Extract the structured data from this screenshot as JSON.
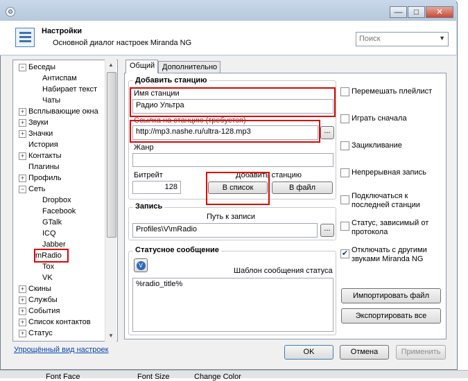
{
  "window": {
    "controls": [
      "—",
      "□",
      "✕"
    ]
  },
  "header": {
    "title": "Настройки",
    "subtitle": "Основной диалог настроек Miranda NG"
  },
  "search": {
    "placeholder": "Поиск"
  },
  "tree": {
    "items": [
      {
        "label": "Беседы",
        "level": 0,
        "expander": "−"
      },
      {
        "label": "Антиспам",
        "level": 1
      },
      {
        "label": "Набирает текст",
        "level": 1
      },
      {
        "label": "Чаты",
        "level": 1
      },
      {
        "label": "Всплывающие окна",
        "level": 0,
        "expander": "+"
      },
      {
        "label": "Звуки",
        "level": 0,
        "expander": "+"
      },
      {
        "label": "Значки",
        "level": 0,
        "expander": "+"
      },
      {
        "label": "История",
        "level": 0
      },
      {
        "label": "Контакты",
        "level": 0,
        "expander": "+"
      },
      {
        "label": "Плагины",
        "level": 0
      },
      {
        "label": "Профиль",
        "level": 0,
        "expander": "+"
      },
      {
        "label": "Сеть",
        "level": 0,
        "expander": "−"
      },
      {
        "label": "Dropbox",
        "level": 1
      },
      {
        "label": "Facebook",
        "level": 1
      },
      {
        "label": "GTalk",
        "level": 1
      },
      {
        "label": "ICQ",
        "level": 1
      },
      {
        "label": "Jabber",
        "level": 1
      },
      {
        "label": "mRadio",
        "level": 1,
        "selected": true
      },
      {
        "label": "Tox",
        "level": 1
      },
      {
        "label": "VK",
        "level": 1
      },
      {
        "label": "Скины",
        "level": 0,
        "expander": "+"
      },
      {
        "label": "Службы",
        "level": 0,
        "expander": "+"
      },
      {
        "label": "События",
        "level": 0,
        "expander": "+"
      },
      {
        "label": "Список контактов",
        "level": 0,
        "expander": "+"
      },
      {
        "label": "Статус",
        "level": 0,
        "expander": "+"
      }
    ]
  },
  "simplified_link": "Упрощённый вид настроек",
  "tabs": [
    "Общий",
    "Дополнительно"
  ],
  "add_station": {
    "title": "Добавить станцию",
    "name_label": "Имя станции",
    "name_value": "Радио Ультра",
    "url_label": "Ссылка на станцию (требуется)",
    "url_value": "http://mp3.nashe.ru/ultra-128.mp3",
    "browse": "...",
    "genre_label": "Жанр",
    "genre_value": "",
    "bitrate_label": "Битрейт",
    "bitrate_value": "128",
    "add_label": "Добавить станцию",
    "to_list": "В список",
    "to_file": "В файл"
  },
  "record": {
    "title": "Запись",
    "path_label": "Путь к записи",
    "path_value": "Profiles\\V\\mRadio",
    "browse": "..."
  },
  "status_msg": {
    "title": "Статусное сообщение",
    "template_label": "Шаблон сообщения статуса",
    "template_value": "%radio_title%"
  },
  "checkboxes": [
    {
      "label": "Перемешать плейлист",
      "checked": false
    },
    {
      "label": "Играть сначала",
      "checked": false
    },
    {
      "label": "Зацикливание",
      "checked": false
    },
    {
      "label": "Непрерывная запись",
      "checked": false
    },
    {
      "label": "Подключаться к последней станции",
      "checked": false
    },
    {
      "label": "Статус, зависимый от протокола",
      "checked": false
    },
    {
      "label": "Отключать с другими звуками Miranda NG",
      "checked": true
    }
  ],
  "buttons": {
    "import": "Импортировать файл",
    "export": "Экспортировать все",
    "ok": "OK",
    "cancel": "Отмена",
    "apply": "Применить"
  },
  "taskbar": {
    "font_face": "Font Face",
    "font_size": "Font Size",
    "change_color": "Change Color"
  },
  "colors": {
    "highlight": "#e00000",
    "link": "#0645ad"
  }
}
